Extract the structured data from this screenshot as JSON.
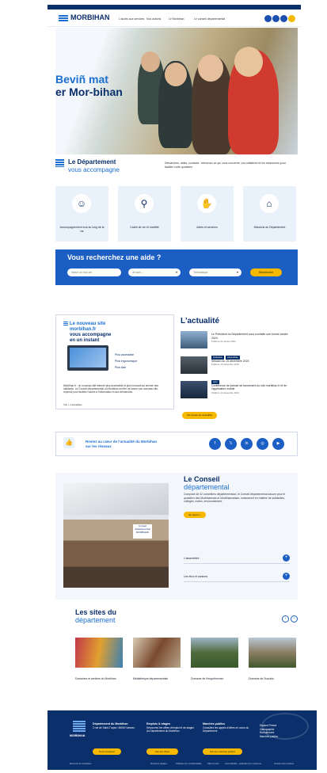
{
  "colors": {
    "navy": "#0b2f6b",
    "blue": "#1b6fd1",
    "accent": "#f6b900",
    "light": "#e9f1fb"
  },
  "header": {
    "brand": "MORBIHAN",
    "nav": [
      "L'accès aux services",
      "Nos actions",
      "Le Morbihan",
      "Le conseil départemental"
    ],
    "icons": [
      "user-icon",
      "accessibility-icon",
      "menu-icon",
      "search-icon"
    ]
  },
  "hero": {
    "line1": "Beviñ mat",
    "line2": "er Mor-bihan"
  },
  "department": {
    "title": "Le Département",
    "subtitle": "vous accompagne",
    "description": "Démarches, aides, contacts : retrouvez ce qui vous concerne, vos initiatives et les ressources pour faciliter votre quotidien",
    "cards": [
      {
        "label": "Accompagnement tout au long de la vie",
        "icon": "family-icon"
      },
      {
        "label": "Cadre de vie et mobilité",
        "icon": "bike-icon"
      },
      {
        "label": "Aides et services",
        "icon": "helping-hand-icon"
      },
      {
        "label": "Missions du Département",
        "icon": "building-icon"
      }
    ]
  },
  "search": {
    "title": "Vous recherchez une aide ?",
    "fields": [
      "Saisir un mot-clé",
      "Je suis...",
      "Thématique"
    ],
    "button": "Rechercher"
  },
  "promo": {
    "line1": "Le nouveau site",
    "line2": "morbihan.fr",
    "line3": "vous accompagne",
    "line4": "en un instant",
    "items": [
      "Plus accessible",
      "Plus ergonomique",
      "Plus clair"
    ],
    "text": "Morbihan.fr : un nouveau site internet plus accessible et plus innovant au service des habitants. Le Conseil départemental du Morbihan est fier de lancer son nouveau site, repensé pour faciliter l'accès à l'information et aux démarches.",
    "link": "Voir + d'actualités"
  },
  "news": {
    "title": "L'actualité",
    "items": [
      {
        "text": "Le Président du Département vous souhaite une bonne année 2024",
        "date": "Publié le 01 janvier 2024",
        "tags": []
      },
      {
        "text": "Session du 15 décembre 2023",
        "date": "Publié le 15 décembre 2023",
        "tags": [
          "Institution",
          "Assemblée"
        ]
      },
      {
        "text": "Conférence de presse de lancement du site morbihan.fr et de l'application mobile",
        "date": "Publié le 14 décembre 2023",
        "tags": [
          "Actu"
        ]
      }
    ],
    "button": "Voir toutes les actualités"
  },
  "social": {
    "text_line1": "Restez au cœur de l'actualité du Morbihan",
    "text_line2": "sur les réseaux",
    "networks": [
      "f",
      "𝕏",
      "in",
      "◎",
      "▶"
    ]
  },
  "council": {
    "title": "Le Conseil",
    "subtitle": "départemental",
    "description": "Composé de 42 conseillers départementaux, le Conseil départemental assure pour le quotidien des Morbihannais et Morbihannaises, notamment en matière de solidarités, collèges, routes, environnement.",
    "button": "En savoir +",
    "photo_sign": "Conseil départemental MORBIHAN",
    "accordion": [
      "L'assemblée",
      "Les élus et cantons"
    ]
  },
  "sites": {
    "title": "Les sites du",
    "subtitle": "département",
    "items": [
      "Domaines et sentiers du Morbihan",
      "Médiathèque départementale",
      "Domaine de Kerguéhennec",
      "Domaine de Suscinio"
    ]
  },
  "footer": {
    "brand": "MORBIHAN",
    "col1_title": "Département du Morbihan",
    "col1_text": "2 rue de Saint-Tropez, 56000 Vannes",
    "col1_button": "Nous contacter",
    "col2_title": "Emplois & stages",
    "col2_text": "Découvrez les offres d'emploi et de stages du Département du Morbihan",
    "col2_button": "Voir les offres",
    "col3_title": "Marchés publics",
    "col3_text": "Consultez les appels d'offres en cours du Département",
    "col3_button": "Voir les marchés publics",
    "col4": [
      "Espace Presse",
      "Cartographie",
      "Recrutement",
      "Marchés publics"
    ],
    "bottom": [
      "Mentions légales",
      "Politique de confidentialité",
      "Plan du site",
      "Accessibilité : partiellement conforme",
      "Gestion des cookies"
    ],
    "newsletter": "Recevoir la newsletter"
  }
}
